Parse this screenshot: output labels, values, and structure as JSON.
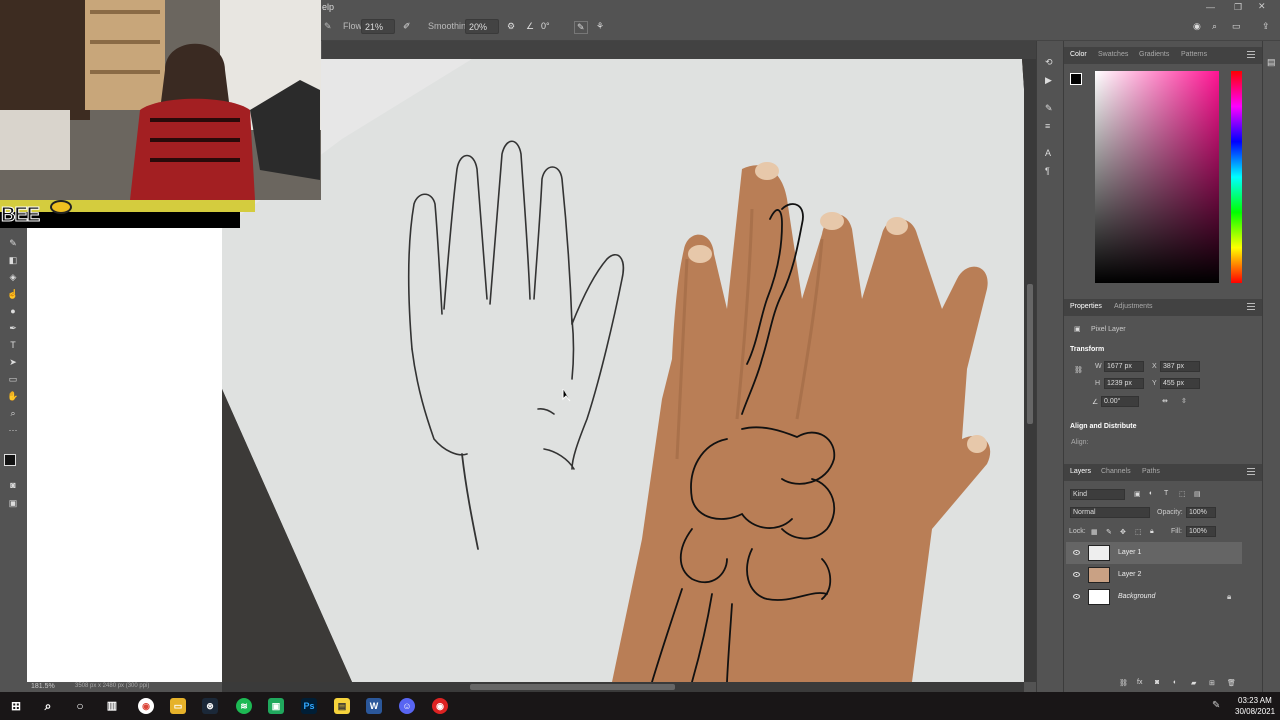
{
  "menubar": {
    "help_fragment": "elp"
  },
  "options": {
    "flow_label": "Flow:",
    "flow_value": "21%",
    "smoothing_label": "Smoothing:",
    "smoothing_value": "20%",
    "angle_value": "0°"
  },
  "webcam": {
    "banner_text": "BEE"
  },
  "status": {
    "zoom": "181.5%",
    "doc_info": "3508 px x 2480 px (300 ppi)"
  },
  "color_panel": {
    "tabs": [
      "Color",
      "Swatches",
      "Gradients",
      "Patterns"
    ],
    "active_tab": "Color",
    "accent": "#ff1493"
  },
  "properties": {
    "tabs": [
      "Properties",
      "Adjustments"
    ],
    "layer_kind": "Pixel Layer",
    "transform_title": "Transform",
    "w_label": "W",
    "w_value": "1677 px",
    "h_label": "H",
    "h_value": "1239 px",
    "x_label": "X",
    "x_value": "387 px",
    "y_label": "Y",
    "y_value": "455 px",
    "angle_value": "0.00°",
    "align_title": "Align and Distribute",
    "align_label": "Align:"
  },
  "layers": {
    "tabs": [
      "Layers",
      "Channels",
      "Paths"
    ],
    "filter_kind": "Kind",
    "blend_mode": "Normal",
    "opacity_label": "Opacity:",
    "opacity_value": "100%",
    "lock_label": "Lock:",
    "fill_label": "Fill:",
    "fill_value": "100%",
    "items": [
      {
        "name": "Layer 1",
        "selected": true
      },
      {
        "name": "Layer 2",
        "selected": false
      },
      {
        "name": "Background",
        "selected": false
      }
    ]
  },
  "taskbar": {
    "time": "03:23 AM",
    "date": "30/08/2021"
  }
}
